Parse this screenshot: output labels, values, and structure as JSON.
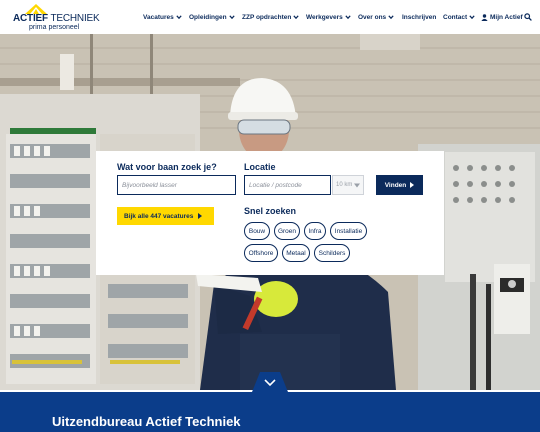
{
  "brand": {
    "name_bold": "ACTIEF",
    "name_light": "TECHNIEK",
    "tagline": "prima personeel",
    "colors": {
      "navy": "#0b2a5b",
      "yellow": "#ffd800",
      "banner_blue": "#0b3d8a"
    }
  },
  "nav": {
    "items": [
      {
        "label": "Vacatures",
        "has_dropdown": true
      },
      {
        "label": "Opleidingen",
        "has_dropdown": true
      },
      {
        "label": "ZZP opdrachten",
        "has_dropdown": true
      },
      {
        "label": "Werkgevers",
        "has_dropdown": true
      },
      {
        "label": "Over ons",
        "has_dropdown": true
      },
      {
        "label": "Inschrijven",
        "has_dropdown": false
      },
      {
        "label": "Contact",
        "has_dropdown": true
      }
    ],
    "account_label": "Mijn Actief",
    "icons": {
      "account": "user-icon",
      "search": "search-icon"
    }
  },
  "search": {
    "job_heading": "Wat voor baan zoek je?",
    "job_placeholder": "Bijvoorbeeld lasser",
    "location_heading": "Locatie",
    "location_placeholder": "Locatie / postcode",
    "radius_value": "10 km",
    "find_label": "Vinden",
    "all_jobs_label": "Bijk alle 447 vacatures",
    "quick_heading": "Snel zoeken",
    "quick_tags": [
      "Bouw",
      "Groen",
      "Infra",
      "Installatie",
      "Offshore",
      "Metaal",
      "Schilders"
    ]
  },
  "banner": {
    "title": "Uitzendbureau Actief Techniek"
  }
}
